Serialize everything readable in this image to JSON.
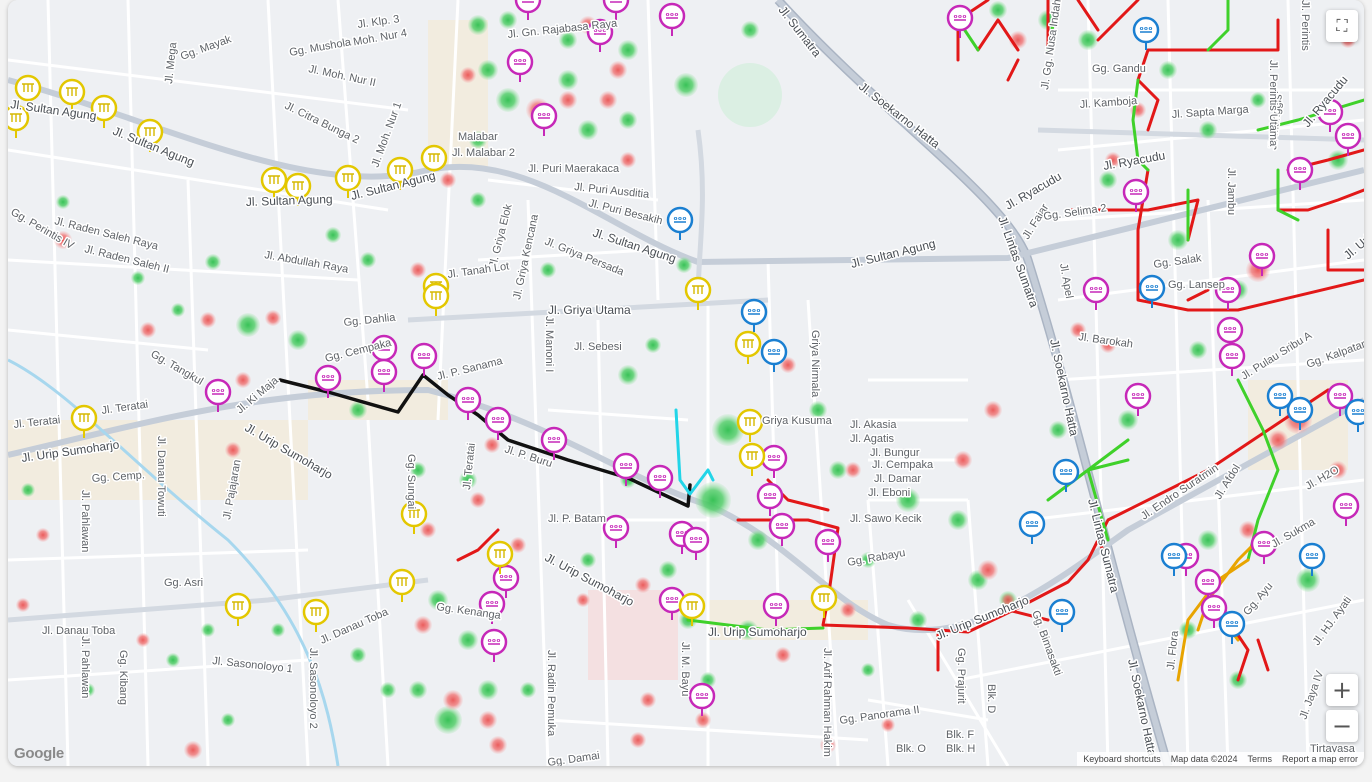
{
  "map": {
    "controls": {
      "fullscreen_icon": "⛶",
      "zoom_in": "+",
      "zoom_out": "−"
    },
    "attribution": {
      "logo": "Google",
      "shortcuts": "Keyboard shortcuts",
      "data": "Map data ©2024",
      "terms": "Terms",
      "report": "Report a map error"
    },
    "colors": {
      "cluster_green": "#3cc15a",
      "cluster_red": "#ea5b5b",
      "magenta_pin": "#c628b8",
      "blue_pin": "#1a7fd1",
      "yellow_pin": "#e3c700",
      "line_black": "#111111",
      "line_red": "#e21818",
      "line_green": "#3fd12a",
      "line_cyan": "#22d5e8",
      "line_orange": "#e8a400"
    },
    "street_labels": {
      "sumatra_top": "Jl. Sumatra",
      "soekarno_hatta_top": "Jl. Soekarno Hatta",
      "lintas_sumatra": "Jl. Lintas Sumatra",
      "soekarno_hatta_mid": "Jl. Soekarno Hatta",
      "lintas_sumatra_bottom": "Jl. Lintas Sumatra",
      "soekarno_hatta_bottom": "Jl. Soekarno Hatta",
      "sultan_agung_1": "Jl. Sultan Agung",
      "sultan_agung_2": "Jl. Sultan Agung",
      "sultan_agung_3": "Jl. Sultan Agung",
      "sultan_agung_4": "Jl. Sultan Agung",
      "sultan_agung_5": "Jl. Sultan Agung",
      "sultan_agung_6": "Jl. Sultan Agung",
      "ryacudu_1": "Jl. Ryacudu",
      "ryacudu_2": "Jl. Ryacudu",
      "ryacudu_3": "Jl. Ryacudu",
      "urip_1": "Jl. Urip Sumoharjo",
      "urip_2": "Jl. Urip Sumoharjo",
      "urip_3": "Jl. Urip Sumoharjo",
      "urip_4": "Jl. Urip Sumoharjo",
      "urip_5": "Jl. Urip Sumoharjo",
      "urip_6": "Jl. Urip Sumoharjo",
      "griya_utama": "Jl. Griya Utama",
      "griya_kencana": "Jl. Griya Kencana",
      "griya_persada": "Jl. Griya Persada",
      "griya_elok": "Jl. Griya Elok",
      "puri_maerakaca": "Jl. Puri Maerakaca",
      "puri_ausditia": "Jl. Puri Ausditia",
      "puri_besakih": "Jl. Puri Besakih",
      "gn_rajabasa": "Jl. Gn. Rajabasa Raya",
      "malabar": "Malabar",
      "malabar2": "Jl. Malabar 2",
      "teratai_1": "Jl. Teratai",
      "teratai_2": "Jl. Teratai",
      "teratai_3": "Jl. Teratai",
      "danau_toba_1": "Jl. Danau Toba",
      "danau_toba_2": "Jl. Danau Toba",
      "danau_towuti": "Jl. Danau Towuti",
      "pahlawan_1": "Jl. Pahlawan",
      "pahlawan_2": "Jl. Pahlawan",
      "pajajaran": "Jl. Pajajaran",
      "ki_maja": "Jl. Ki Maja",
      "gg_cempaka": "Gg. Cempaka",
      "gg_cemp": "Gg. Cemp.",
      "gg_dahlia": "Gg. Dahlia",
      "gg_tangkul": "Gg. Tangkul",
      "gg_asri": "Gg. Asri",
      "gg_kibang": "Gg. Kibang",
      "sasonoloyo": "Jl. Sasonoloyo 1",
      "sasonoloyo2": "Jl. Sasonoloyo 2",
      "raden_saleh_raya": "Jl. Raden Saleh Raya",
      "raden_saleh_ii": "Jl. Raden Saleh II",
      "perintis_iv": "Gg. Perintis IV",
      "abdullah_raya": "Jl. Abdullah Raya",
      "tanah_lot": "Jl. Tanah Lot",
      "citra_bunga": "Jl. Citra Bunga 2",
      "moh_nur": "Jl. Moh. Nur 1",
      "moh_nur_ii": "Jl. Moh. Nur II",
      "moh_nur_4": "Jl. Moh. Nur 4",
      "klp3": "Jl. Klp. 3",
      "gg_mayak": "Gg. Mayak",
      "gg_mushola": "Gg. Mushola",
      "jl_mega": "Jl. Mega",
      "p_sanama": "Jl. P. Sanama",
      "p_batam": "Jl. P. Batam",
      "p_buru": "Jl. P. Buru",
      "sebesi": "Jl. Sebesi",
      "manoni": "Jl. Manoni I",
      "akasia": "Jl. Akasia",
      "agatis": "Jl. Agatis",
      "bungur": "Jl. Bungur",
      "cempaka_2": "Jl. Cempaka",
      "damar": "Jl. Damar",
      "eboni": "Jl. Eboni",
      "sawo_kecik": "Jl. Sawo Kecik",
      "griya_kusuma": "Griya Kusuma",
      "griya_nirmala": "Griya Nirmala",
      "gg_rabayu": "Gg. Rabayu",
      "arif_rahman_hakim": "Jl. Arif Rahman Hakim",
      "jl_m_bayu": "Jl. M. Bayu",
      "radin_pemuka": "Jl. Radin Pemuka",
      "gg_panorama": "Gg. Panorama II",
      "blk_o": "Blk. O",
      "blk_h": "Blk. H",
      "blk_f": "Blk. F",
      "blk_d": "Blk. D",
      "gg_damai": "Gg. Damai",
      "gg_prajurit": "Gg. Prajurit",
      "gg_bimasakti": "Gg. Bimasakti",
      "jl_fajar": "Jl. Fajar",
      "jl_apel": "Jl. Apel",
      "barokah": "Jl. Barokah",
      "gg_salak": "Gg. Salak",
      "gg_selima": "Gg. Selima 2",
      "jl_kamboja": "Jl. Kamboja",
      "sapta_marga": "Jl. Sapta Marga",
      "jl_jambu": "Jl. Jambu",
      "jl_manggis": "Jl. Manggis",
      "perintis_utama": "Jl. Perintis Utama",
      "perintis": "Jl. Perintis",
      "pulau_sribu": "Jl. Pulau Sribu A",
      "gg_kalpataru": "Gg. Kalpataru",
      "afdol": "Jl. Afdol",
      "endro_suratmin": "Jl. Endro Suratmin",
      "h2o": "Jl. H2O",
      "sukma": "Jl. Sukma",
      "jl_flora": "Jl. Flora",
      "gg_ayu": "Gg. Ayu",
      "hj_ayati": "Jl. HJ. Ayati",
      "tirtayasa": "Tirtayasa",
      "jl_jaya": "Jl. Jaya IV",
      "jl_gg_nusa": "Jl. Gg. Nusa Indah",
      "gg_gandu": "Gg. Gandu",
      "gg_lansep": "Gg. Lansep",
      "gg_sungai": "Gg. Sungai",
      "kenanga": "Gg. Kenanga"
    }
  }
}
